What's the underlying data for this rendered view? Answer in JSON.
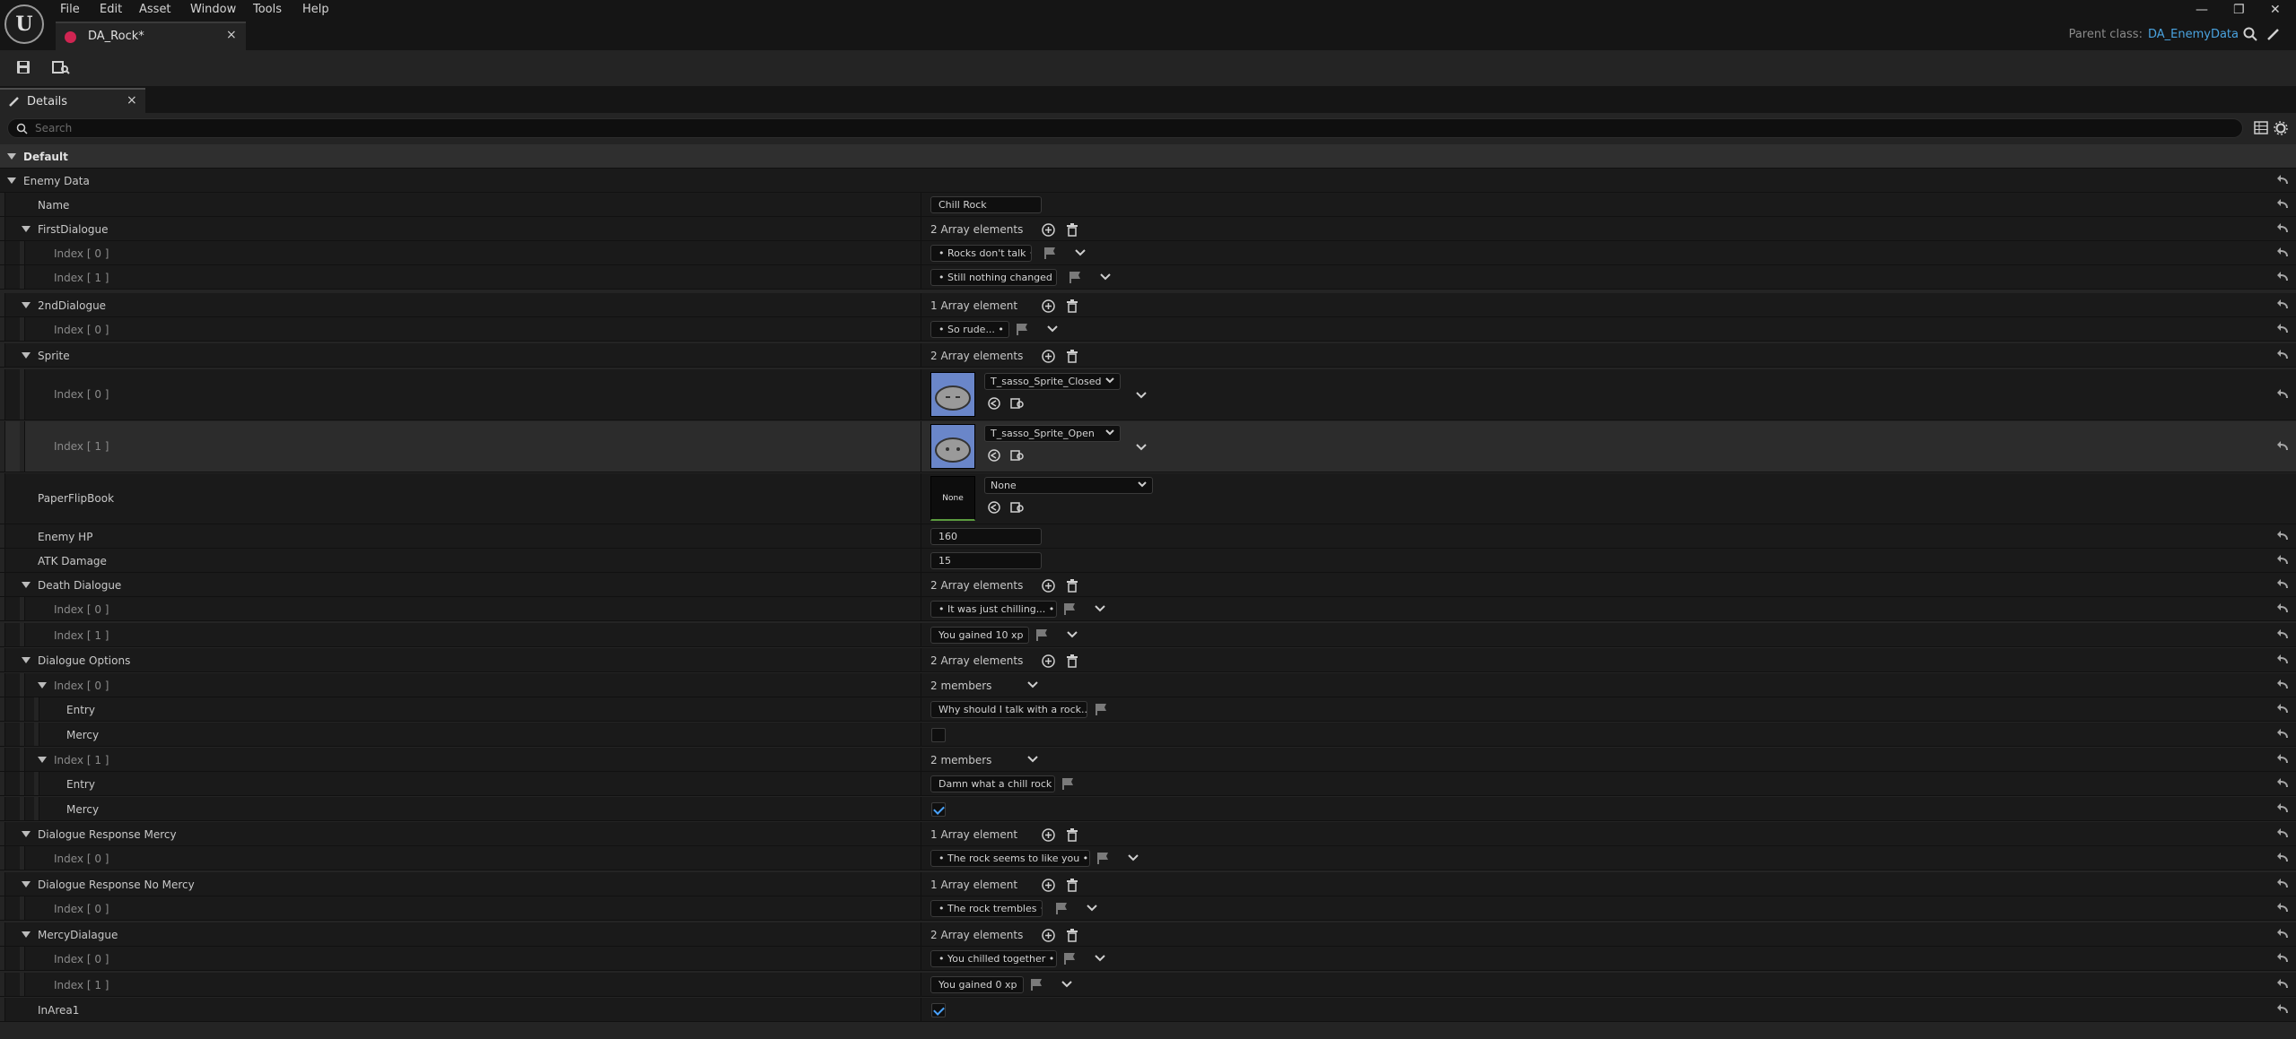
{
  "window": {
    "menus": [
      "File",
      "Edit",
      "Asset",
      "Window",
      "Tools",
      "Help"
    ],
    "tab_title": "DA_Rock*",
    "parent_class_label": "Parent class:",
    "parent_class_value": "DA_EnemyData"
  },
  "details": {
    "tab_label": "Details",
    "search_placeholder": "Search"
  },
  "colors": {
    "accent_link": "#4aa3e0",
    "asset_tab_dot": "#d02552",
    "checkbox_check": "#4aa3ff",
    "thumb_bg": "#6a86c9"
  },
  "rows": {
    "default": "Default",
    "enemy_data": "Enemy Data",
    "name": {
      "label": "Name",
      "value": "Chill Rock"
    },
    "first_dialogue": {
      "label": "FirstDialogue",
      "count": "2 Array elements",
      "i0": "Index [ 0 ]",
      "v0": "• Rocks don't talk •",
      "i1": "Index [ 1 ]",
      "v1": "• Still nothing changed •"
    },
    "second_dialogue": {
      "label": "2ndDialogue",
      "count": "1 Array element",
      "i0": "Index [ 0 ]",
      "v0": "• So rude... •"
    },
    "sprite": {
      "label": "Sprite",
      "count": "2 Array elements",
      "i0": "Index [ 0 ]",
      "v0": "T_sasso_Sprite_Closed",
      "i1": "Index [ 1 ]",
      "v1": "T_sasso_Sprite_Open"
    },
    "flipbook": {
      "label": "PaperFlipBook",
      "thumb": "None",
      "value": "None"
    },
    "enemy_hp": {
      "label": "Enemy HP",
      "value": "160"
    },
    "atk_damage": {
      "label": "ATK Damage",
      "value": "15"
    },
    "death_dialogue": {
      "label": "Death Dialogue",
      "count": "2 Array elements",
      "i0": "Index [ 0 ]",
      "v0": "• It was just chilling... •",
      "i1": "Index [ 1 ]",
      "v1": "You gained 10 xp"
    },
    "dialogue_options": {
      "label": "Dialogue Options",
      "count": "2 Array elements",
      "i0": "Index [ 0 ]",
      "m0": "2 members",
      "entry_label": "Entry",
      "mercy_label": "Mercy",
      "e0": "Why should I talk with a rock...",
      "i1": "Index [ 1 ]",
      "m1": "2 members",
      "e1": "Damn what a chill rock"
    },
    "resp_mercy": {
      "label": "Dialogue Response Mercy",
      "count": "1 Array element",
      "i0": "Index [ 0 ]",
      "v0": "• The rock seems to like you •"
    },
    "resp_nomercy": {
      "label": "Dialogue Response No Mercy",
      "count": "1 Array element",
      "i0": "Index [ 0 ]",
      "v0": "• The rock trembles •"
    },
    "mercy_dialogue": {
      "label": "MercyDialague",
      "count": "2 Array elements",
      "i0": "Index [ 0 ]",
      "v0": "• You chilled together •",
      "i1": "Index [ 1 ]",
      "v1": "You gained 0 xp"
    },
    "in_area": {
      "label": "InArea1"
    }
  },
  "checkboxes": {
    "mercy_0": false,
    "mercy_1": true,
    "in_area": true
  }
}
